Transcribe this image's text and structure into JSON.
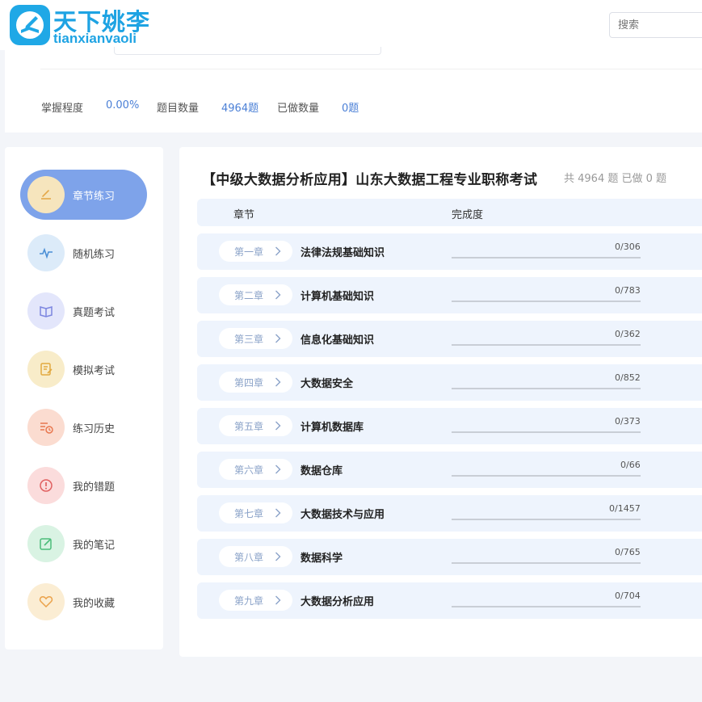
{
  "brand": {
    "title": "天下姚李",
    "subtitle": "tianxianvaoli",
    "color": "#1ea3e3"
  },
  "search": {
    "placeholder": "搜索"
  },
  "stats": [
    {
      "label": "掌握程度",
      "value": "0.00%"
    },
    {
      "label": "题目数量",
      "value": "4964题"
    },
    {
      "label": "已做数量",
      "value": "0题"
    }
  ],
  "sidebar": {
    "items": [
      {
        "label": "章节练习",
        "icon": "pencil-icon",
        "active": true
      },
      {
        "label": "随机练习",
        "icon": "pulse-icon",
        "active": false
      },
      {
        "label": "真题考试",
        "icon": "book-icon",
        "active": false
      },
      {
        "label": "模拟考试",
        "icon": "edit-document-icon",
        "active": false
      },
      {
        "label": "练习历史",
        "icon": "history-icon",
        "active": false
      },
      {
        "label": "我的错题",
        "icon": "alert-icon",
        "active": false
      },
      {
        "label": "我的笔记",
        "icon": "note-icon",
        "active": false
      },
      {
        "label": "我的收藏",
        "icon": "heart-icon",
        "active": false
      }
    ]
  },
  "main": {
    "title": "【中级大数据分析应用】山东大数据工程专业职称考试",
    "summary": "共 4964 题 已做 0 题",
    "columns": {
      "chapter": "章节",
      "completion": "完成度"
    },
    "rows": [
      {
        "chapter": "第一章",
        "name": "法律法规基础知识",
        "done": 0,
        "total": 306,
        "progress": "0/306"
      },
      {
        "chapter": "第二章",
        "name": "计算机基础知识",
        "done": 0,
        "total": 783,
        "progress": "0/783"
      },
      {
        "chapter": "第三章",
        "name": "信息化基础知识",
        "done": 0,
        "total": 362,
        "progress": "0/362"
      },
      {
        "chapter": "第四章",
        "name": "大数据安全",
        "done": 0,
        "total": 852,
        "progress": "0/852"
      },
      {
        "chapter": "第五章",
        "name": "计算机数据库",
        "done": 0,
        "total": 373,
        "progress": "0/373"
      },
      {
        "chapter": "第六章",
        "name": "数据仓库",
        "done": 0,
        "total": 66,
        "progress": "0/66"
      },
      {
        "chapter": "第七章",
        "name": "大数据技术与应用",
        "done": 0,
        "total": 1457,
        "progress": "0/1457"
      },
      {
        "chapter": "第八章",
        "name": "数据科学",
        "done": 0,
        "total": 765,
        "progress": "0/765"
      },
      {
        "chapter": "第九章",
        "name": "大数据分析应用",
        "done": 0,
        "total": 704,
        "progress": "0/704"
      }
    ]
  },
  "colors": {
    "accent": "#4a7fd6",
    "active_menu": "#7ea3ea",
    "row_bg": "#eef4fd"
  }
}
